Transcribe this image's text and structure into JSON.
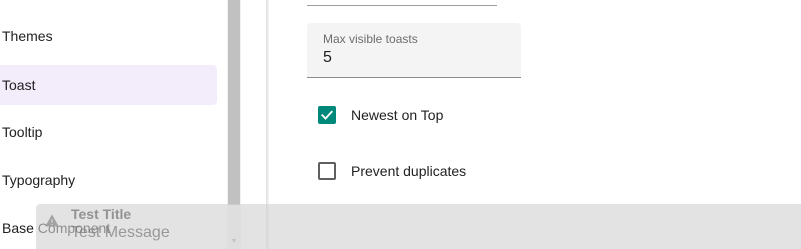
{
  "sidebar": {
    "items": [
      {
        "label": "Themes"
      },
      {
        "label": "Toast",
        "active": true
      },
      {
        "label": "Tooltip"
      },
      {
        "label": "Typography"
      },
      {
        "label": "Base Component"
      }
    ]
  },
  "settings": {
    "max_visible_toasts": {
      "label": "Max visible toasts",
      "value": "5"
    },
    "newest_on_top": {
      "label": "Newest on Top",
      "checked": true
    },
    "prevent_duplicates": {
      "label": "Prevent duplicates",
      "checked": false
    }
  },
  "toast": {
    "title": "Test Title",
    "message": "Test Message",
    "icon": "warning-icon"
  },
  "colors": {
    "accent": "#00897b",
    "active_nav_bg": "#f3ecfb",
    "field_bg": "#f4f4f4"
  }
}
